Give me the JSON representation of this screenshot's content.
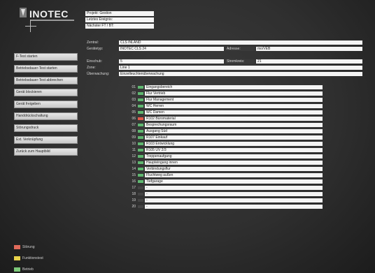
{
  "logo": {
    "text": "INOTEC"
  },
  "project": {
    "fields": [
      "Projekt:  Gestion",
      "Letztes Ereignis:",
      "Nächster FT / BT:"
    ]
  },
  "sidebar": {
    "buttons": [
      "F-Test starten",
      "Betriebsdauer-Test starten",
      "Betriebsdauer-Test abbrechen",
      "Gerät blockieren",
      "Gerät freigeben",
      "Handdrückschaltung",
      "Störungsdruck",
      "Ext. Verknüpfung",
      "Zurück zum Hauptbild"
    ]
  },
  "device": {
    "zentrale_label": "Zentral:",
    "zentrale_value": "CLS INLAND",
    "geraetetyp_label": "Gerätetyp:",
    "geraetetyp_value": "INOTEC CLS 24",
    "adresse_label": "Adresse:",
    "adresse_value": "mo/VEB",
    "einschub_label": "Einschub:",
    "einschub_value": "5",
    "stromkreis_label": "Stromkreis:",
    "stromkreis_value": "21",
    "zone_label": "Zone:",
    "zone_value": "Line 1",
    "ueberwachung_label": "Überwachung:",
    "ueberwachung_value": "Einzelleuchtenüberwachung"
  },
  "circuits": [
    {
      "num": "01",
      "name": "Eingangsbereich",
      "status": "ok"
    },
    {
      "num": "02",
      "name": "Flur Vertrieb",
      "status": "ok"
    },
    {
      "num": "03",
      "name": "Flur Management",
      "status": "ok"
    },
    {
      "num": "04",
      "name": "WC Herren",
      "status": "ok"
    },
    {
      "num": "05",
      "name": "WC Damen",
      "status": "ok"
    },
    {
      "num": "06",
      "name": "R102 Büromaterial",
      "status": "fault"
    },
    {
      "num": "07",
      "name": "Besprechungsraum",
      "status": "ok"
    },
    {
      "num": "08",
      "name": "Ausgang Süd",
      "status": "ok"
    },
    {
      "num": "09",
      "name": "R107 Einkauf",
      "status": "ok"
    },
    {
      "num": "10",
      "name": "R103 Entwicklung",
      "status": "ok"
    },
    {
      "num": "11",
      "name": "R105 UV 2/3",
      "status": "ok"
    },
    {
      "num": "12",
      "name": "Treppenaufgang",
      "status": "ok"
    },
    {
      "num": "13",
      "name": "Hauptеingang innen",
      "status": "ok"
    },
    {
      "num": "14",
      "name": "Verbindungsflur",
      "status": "ok"
    },
    {
      "num": "15",
      "name": "Fluchtweg außen",
      "status": "ok"
    },
    {
      "num": "16",
      "name": "Tiefgarage",
      "status": "ok"
    },
    {
      "num": "17",
      "name": "-",
      "status": "none"
    },
    {
      "num": "18",
      "name": "-",
      "status": "none"
    },
    {
      "num": "19",
      "name": "-",
      "status": "none"
    },
    {
      "num": "20",
      "name": "-",
      "status": "none"
    }
  ],
  "legend": [
    {
      "label": "Störung",
      "color": "#e06a5a"
    },
    {
      "label": "Funktionstest",
      "color": "#e7d24a"
    },
    {
      "label": "Betrieb",
      "color": "#7dc97a"
    }
  ],
  "colors": {
    "ok": "#5fb870",
    "fault": "#e05a4a",
    "none": "#444444"
  }
}
